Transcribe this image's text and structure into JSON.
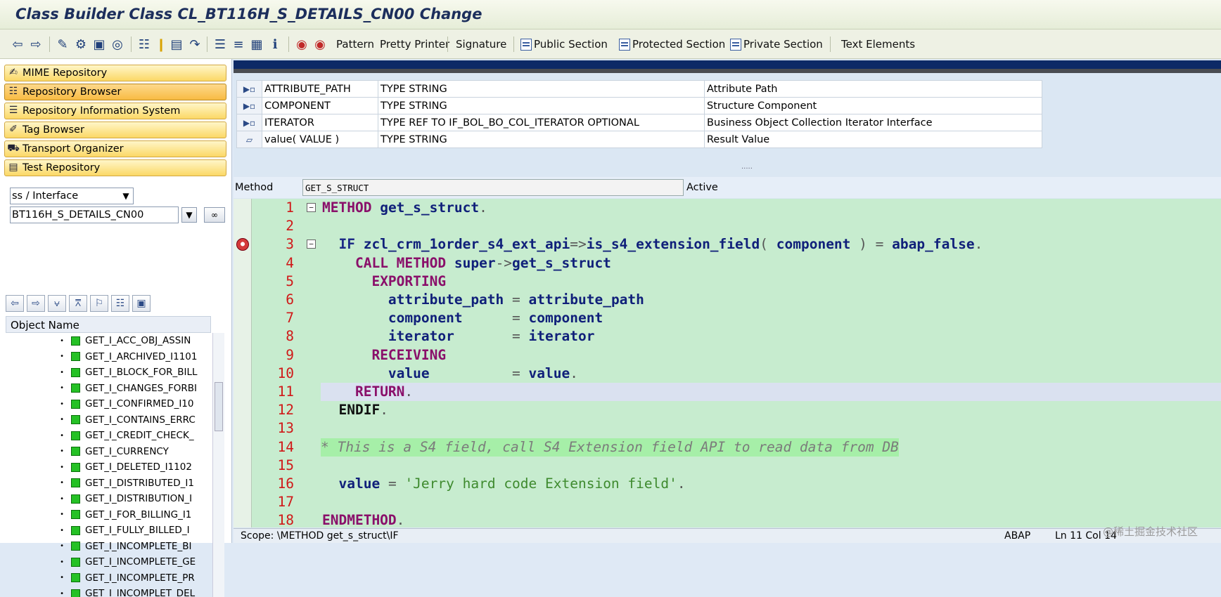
{
  "window": {
    "title": "Class Builder Class CL_BT116H_S_DETAILS_CN00 Change"
  },
  "toolbar": {
    "pattern": "Pattern",
    "pretty_printer": "Pretty Printer",
    "signature": "Signature",
    "public_section": "Public Section",
    "protected_section": "Protected Section",
    "private_section": "Private Section",
    "text_elements": "Text Elements"
  },
  "nav": {
    "items": [
      {
        "label": "MIME Repository"
      },
      {
        "label": "Repository Browser"
      },
      {
        "label": "Repository Information System"
      },
      {
        "label": "Tag Browser"
      },
      {
        "label": "Transport Organizer"
      },
      {
        "label": "Test Repository"
      }
    ],
    "selected_index": 1
  },
  "browser": {
    "type_value": "ss / Interface",
    "object_value": "BT116H_S_DETAILS_CN00",
    "column_header": "Object Name",
    "objects": [
      "GET_I_ACC_OBJ_ASSIN",
      "GET_I_ARCHIVED_I1101",
      "GET_I_BLOCK_FOR_BILL",
      "GET_I_CHANGES_FORBI",
      "GET_I_CONFIRMED_I10",
      "GET_I_CONTAINS_ERRC",
      "GET_I_CREDIT_CHECK_",
      "GET_I_CURRENCY",
      "GET_I_DELETED_I1102",
      "GET_I_DISTRIBUTED_I1",
      "GET_I_DISTRIBUTION_I",
      "GET_I_FOR_BILLING_I1",
      "GET_I_FULLY_BILLED_I",
      "GET_I_INCOMPLETE_BI",
      "GET_I_INCOMPLETE_GE",
      "GET_I_INCOMPLETE_PR",
      "GET_I_INCOMPLET_DEL"
    ]
  },
  "params": [
    {
      "name": "ATTRIBUTE_PATH",
      "type": "TYPE STRING",
      "desc": "Attribute Path",
      "icon": "importing-param-icon"
    },
    {
      "name": "COMPONENT",
      "type": "TYPE STRING",
      "desc": "Structure Component",
      "icon": "importing-param-icon"
    },
    {
      "name": "ITERATOR",
      "type": "TYPE REF TO IF_BOL_BO_COL_ITERATOR OPTIONAL",
      "desc": "Business Object Collection Iterator Interface",
      "icon": "importing-param-icon"
    },
    {
      "name": "value( VALUE )",
      "type": "TYPE STRING",
      "desc": "Result Value",
      "icon": "returning-param-icon"
    }
  ],
  "method": {
    "label": "Method",
    "name": "GET_S_STRUCT",
    "status": "Active"
  },
  "status_bar": {
    "scope": "Scope: \\METHOD get_s_struct\\IF",
    "lang": "ABAP",
    "position": "Ln  11 Col  14"
  },
  "watermark": "@稀土掘金技术社区",
  "code": [
    "1",
    "2",
    "3",
    "4",
    "5",
    "6",
    "7",
    "8",
    "9",
    "10",
    "11",
    "12",
    "13",
    "14",
    "15",
    "16",
    "17",
    "18"
  ],
  "colors": {
    "editor_bg": "#c7eccf",
    "highlight": "#dae1f0",
    "keyword": "#8a0f6a",
    "nav_button": "#fbd866"
  }
}
